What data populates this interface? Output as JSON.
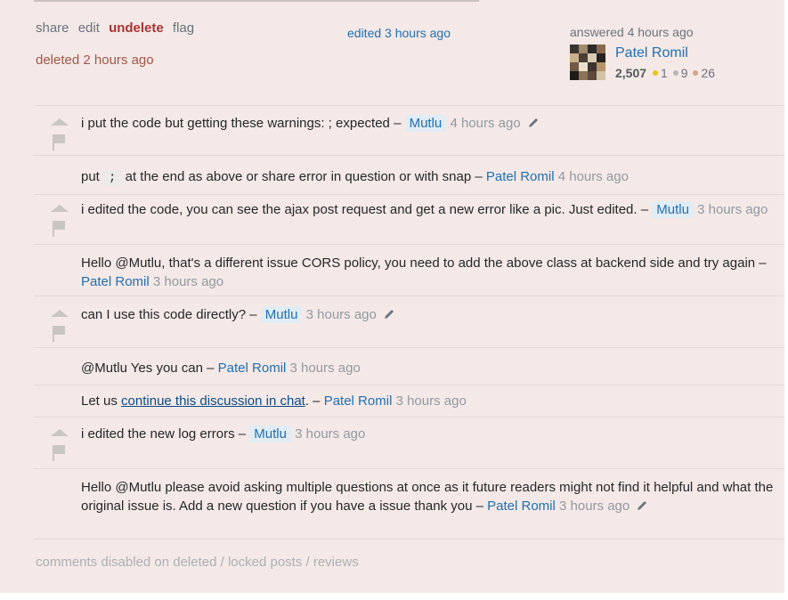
{
  "post_menu": {
    "share": "share",
    "edit": "edit",
    "undelete": "undelete",
    "flag": "flag",
    "deleted_note": "deleted 2 hours ago"
  },
  "edited": "edited 3 hours ago",
  "usercard": {
    "action": "answered 4 hours ago",
    "name": "Patel Romil",
    "reputation": "2,507",
    "gold": "1",
    "silver": "9",
    "bronze": "26"
  },
  "comments": [
    {
      "text": "i put the code but getting these warnings: ; expected –",
      "user": "Mutlu",
      "date": "4 hours ago"
    },
    {
      "text_pre": "put",
      "code": ";",
      "text_post": "at the end as above or share error in question or with snap –",
      "user": "Patel Romil",
      "date": "4 hours ago"
    },
    {
      "text": "i edited the code, you can see the ajax post request and get a new error like a pic. Just edited. –",
      "user": "Mutlu",
      "date": "3 hours ago"
    },
    {
      "text": "Hello @Mutlu, that's a different issue CORS policy, you need to add the above class at backend side and try again –",
      "user": "Patel Romil",
      "date": "3 hours ago"
    },
    {
      "text": "can I use this code directly? –",
      "user": "Mutlu",
      "date": "3 hours ago"
    },
    {
      "text": "@Mutlu Yes you can –",
      "user": "Patel Romil",
      "date": "3 hours ago"
    },
    {
      "text_pre": "Let us",
      "link": "continue this discussion in chat",
      "text_post": ". –",
      "user": "Patel Romil",
      "date": "3 hours ago"
    },
    {
      "text": "i edited the new log errors –",
      "user": "Mutlu",
      "date": "3 hours ago"
    },
    {
      "text": "Hello @Mutlu please avoid asking multiple questions at once as it future readers might not find it helpful and what the original issue is. Add a new question if you have a issue thank you –",
      "user": "Patel Romil",
      "date": "3 hours ago"
    }
  ],
  "footer": "comments disabled on deleted / locked posts / reviews",
  "colors": {
    "link": "#1f6fb2",
    "undelete": "#aa3333",
    "deleted": "#a0564a",
    "panel": "#f4e9e7"
  }
}
